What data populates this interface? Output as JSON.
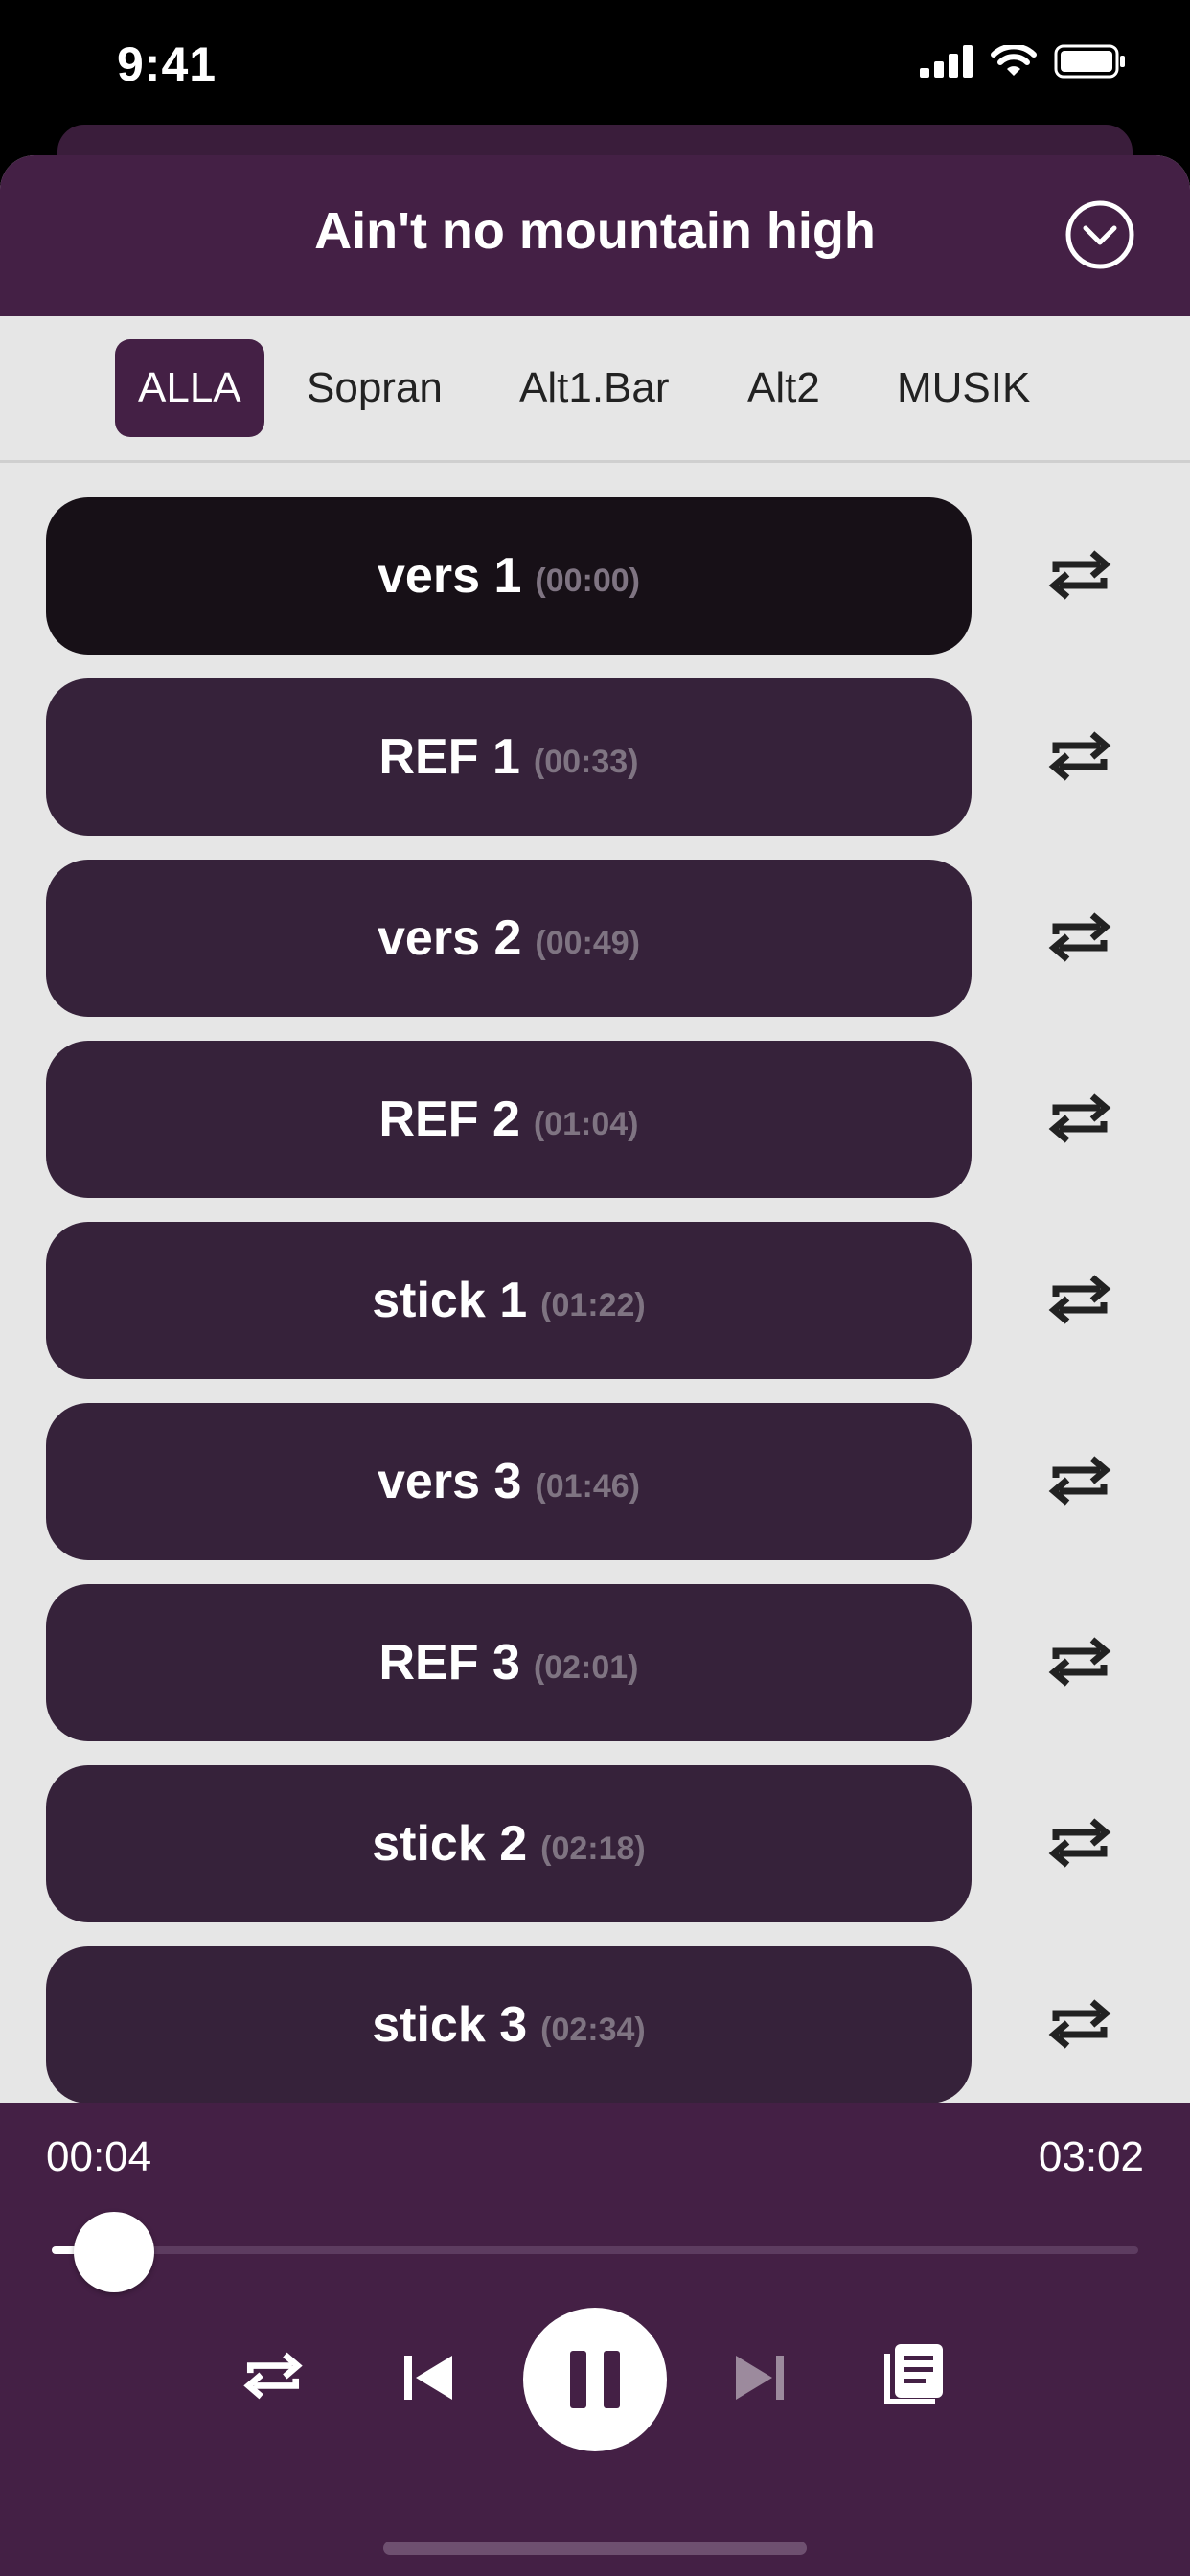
{
  "status_bar": {
    "time": "9:41"
  },
  "header": {
    "title": "Ain't no mountain high"
  },
  "tabs": [
    {
      "label": "ALLA",
      "active": true
    },
    {
      "label": "Sopran",
      "active": false
    },
    {
      "label": "Alt1.Bar",
      "active": false
    },
    {
      "label": "Alt2",
      "active": false
    },
    {
      "label": "MUSIK",
      "active": false
    }
  ],
  "sections": [
    {
      "name": "vers 1",
      "time": "(00:00)",
      "current": true
    },
    {
      "name": "REF 1",
      "time": "(00:33)"
    },
    {
      "name": "vers 2",
      "time": "(00:49)"
    },
    {
      "name": "REF 2",
      "time": "(01:04)"
    },
    {
      "name": "stick 1",
      "time": "(01:22)"
    },
    {
      "name": "vers 3",
      "time": "(01:46)"
    },
    {
      "name": "REF 3",
      "time": "(02:01)"
    },
    {
      "name": "stick 2",
      "time": "(02:18)"
    },
    {
      "name": "stick 3",
      "time": "(02:34)"
    }
  ],
  "player": {
    "current_time": "00:04",
    "total_time": "03:02",
    "progress_fraction": 0.022
  },
  "icons": {
    "collapse": "chevron-down-circle-icon",
    "loop": "repeat-icon",
    "previous": "skip-previous-icon",
    "pause": "pause-icon",
    "next": "skip-next-icon",
    "lyrics": "document-icon"
  },
  "colors": {
    "brand": "#442045",
    "section_pill": "#36223a",
    "section_pill_current": "#171017",
    "background": "#e6e6e6"
  }
}
